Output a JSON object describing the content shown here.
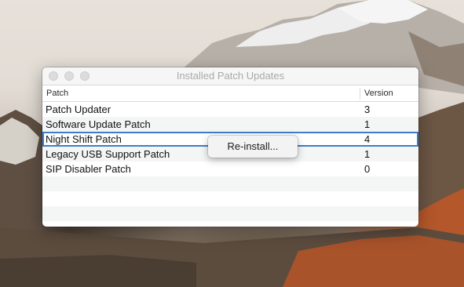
{
  "window": {
    "title": "Installed Patch Updates"
  },
  "table": {
    "columns": [
      "Patch",
      "Version"
    ],
    "rows": [
      {
        "name": "Patch Updater",
        "version": "3"
      },
      {
        "name": "Software Update Patch",
        "version": "1"
      },
      {
        "name": "Night Shift Patch",
        "version": "4",
        "selected": true
      },
      {
        "name": "Legacy USB Support Patch",
        "version": "1"
      },
      {
        "name": "SIP Disabler Patch",
        "version": "0"
      }
    ]
  },
  "context_menu": {
    "items": [
      "Re-install..."
    ]
  },
  "colors": {
    "selection_outline": "#3d7dcc"
  }
}
